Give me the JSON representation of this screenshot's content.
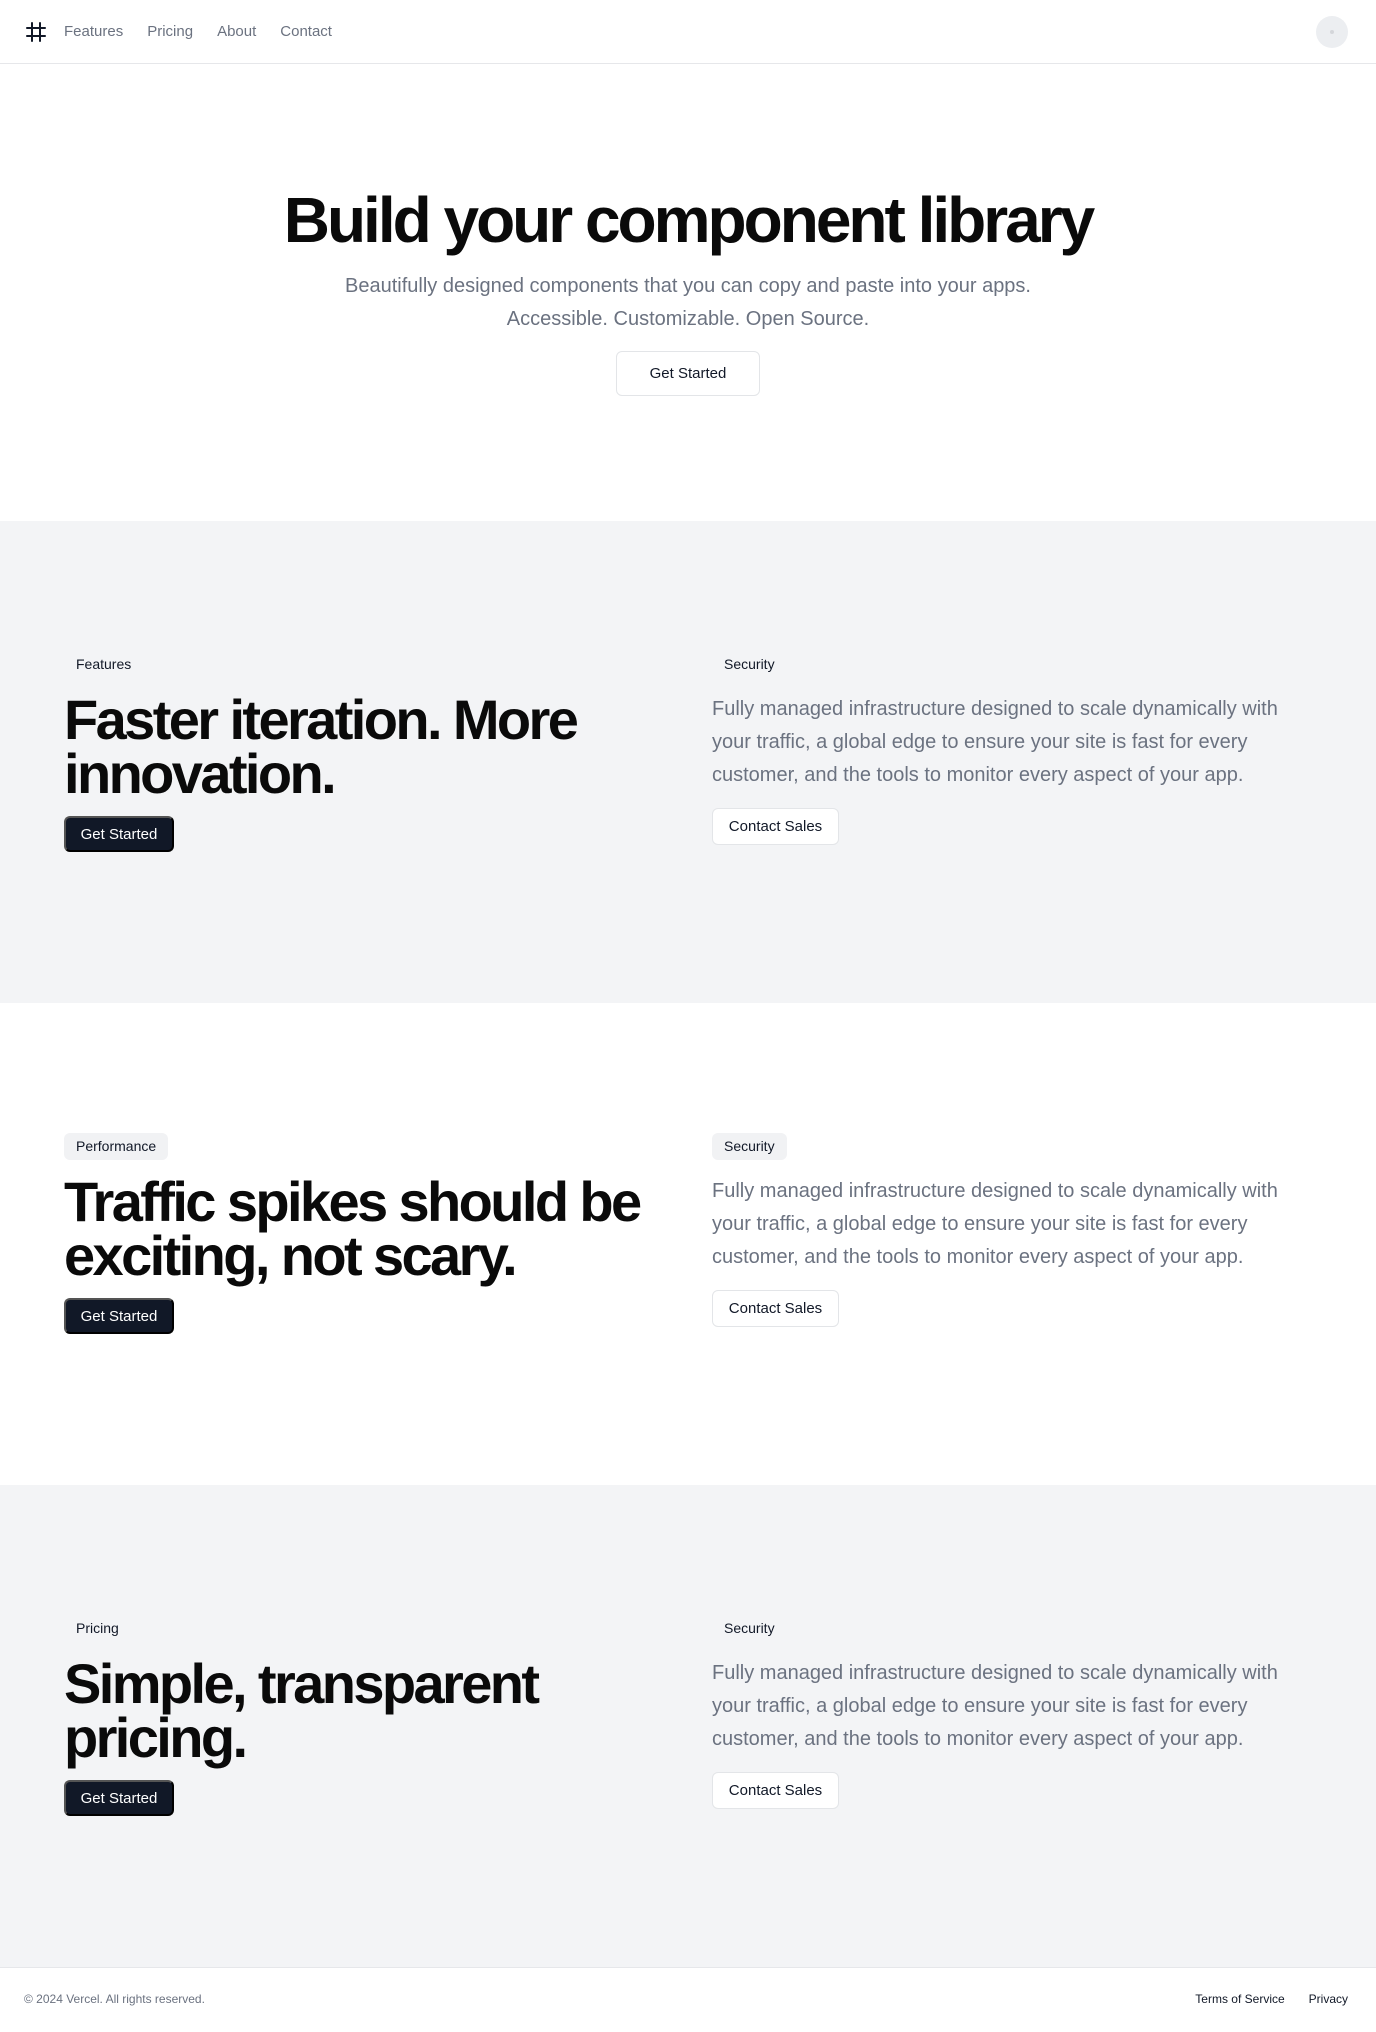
{
  "header": {
    "logo_icon": "hash-grid-icon",
    "nav": [
      "Features",
      "Pricing",
      "About",
      "Contact"
    ]
  },
  "hero": {
    "title": "Build your component library",
    "subtitle": "Beautifully designed components that you can copy and paste into your apps. Accessible. Customizable. Open Source.",
    "cta": "Get Started"
  },
  "sections": [
    {
      "tag": "Features",
      "title": "Faster iteration. More innovation.",
      "cta": "Get Started",
      "right_tag": "Security",
      "description": "Fully managed infrastructure designed to scale dynamically with your traffic, a global edge to ensure your site is fast for every customer, and the tools to monitor every aspect of your app.",
      "secondary_cta": "Contact Sales"
    },
    {
      "tag": "Performance",
      "title": "Traffic spikes should be exciting, not scary.",
      "cta": "Get Started",
      "right_tag": "Security",
      "description": "Fully managed infrastructure designed to scale dynamically with your traffic, a global edge to ensure your site is fast for every customer, and the tools to monitor every aspect of your app.",
      "secondary_cta": "Contact Sales"
    },
    {
      "tag": "Pricing",
      "title": "Simple, transparent pricing.",
      "cta": "Get Started",
      "right_tag": "Security",
      "description": "Fully managed infrastructure designed to scale dynamically with your traffic, a global edge to ensure your site is fast for every customer, and the tools to monitor every aspect of your app.",
      "secondary_cta": "Contact Sales"
    }
  ],
  "footer": {
    "copyright": "© 2024 Vercel. All rights reserved.",
    "links": [
      "Terms of Service",
      "Privacy"
    ]
  },
  "colors": {
    "primary_button": "#111827",
    "muted_text": "#6b7280",
    "gray_section": "#f3f4f6"
  }
}
